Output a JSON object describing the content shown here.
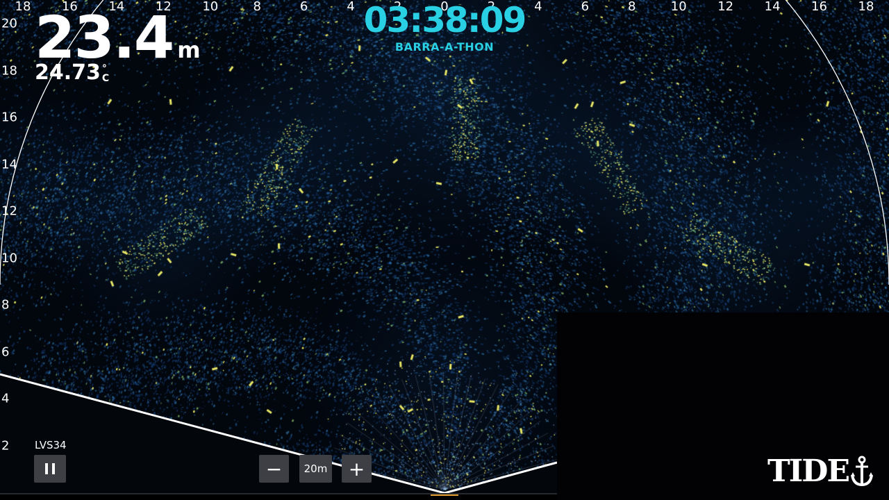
{
  "top_scale": [
    "18",
    "16",
    "14",
    "12",
    "10",
    "8",
    "6",
    "4",
    "2",
    "0",
    "2",
    "4",
    "6",
    "8",
    "10",
    "12",
    "14",
    "16",
    "18"
  ],
  "left_scale": [
    "20",
    "18",
    "16",
    "14",
    "12",
    "10",
    "8",
    "6",
    "4",
    "2"
  ],
  "depth": {
    "value": "23.4",
    "unit": "m"
  },
  "temperature": {
    "value": "24.73",
    "unit_degree": "°",
    "unit_letter": "C"
  },
  "timer": {
    "time": "03:38:09",
    "label": "BARRA-A-THON"
  },
  "transducer": {
    "label": "LVS34"
  },
  "controls": {
    "minus": "−",
    "range": "20m",
    "plus": "+"
  },
  "logo": {
    "text": "TIDE"
  },
  "colors": {
    "timer": "#29cfe3",
    "echo_blue": "#1e5fa8",
    "echo_yellow": "#f4f36a",
    "button_bg": "#3d3f44"
  },
  "icons": {
    "pause": "pause-icon",
    "anchor": "anchor-icon"
  }
}
